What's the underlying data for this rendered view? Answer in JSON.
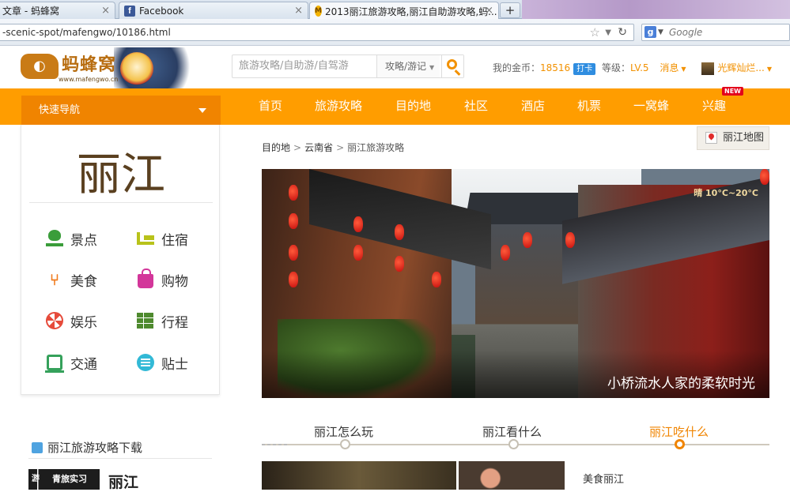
{
  "browser": {
    "tabs": [
      {
        "title": "文章 - 蚂蜂窝"
      },
      {
        "title": "Facebook"
      },
      {
        "title": "2013丽江旅游攻略,丽江自助游攻略,蚂..."
      }
    ],
    "new_tab": "+",
    "url": "-scenic-spot/mafengwo/10186.html",
    "search_engine": "Google",
    "search_engine_letter": "g"
  },
  "header": {
    "logo_text": "蚂蜂窝",
    "logo_url": "www.mafengwo.cn",
    "search_placeholder": "旅游攻略/自助游/自驾游",
    "search_scope": "攻略/游记",
    "coins_label": "我的金币：",
    "coins_value": "18516",
    "checkin": "打卡",
    "level_label": "等级：",
    "level_value": "LV.5",
    "messages": "消息",
    "username": "光辉灿烂..."
  },
  "nav": {
    "quick_nav": "快速导航",
    "items": [
      "首页",
      "旅游攻略",
      "目的地",
      "社区",
      "酒店",
      "机票",
      "一窝蜂",
      "兴趣"
    ],
    "new_badge": "NEW"
  },
  "sidebar": {
    "city": "丽江",
    "categories": [
      "景点",
      "住宿",
      "美食",
      "购物",
      "娱乐",
      "行程",
      "交通",
      "贴士"
    ],
    "download_title": "丽江旅游攻略下载",
    "download_cover_text": "青旅实习",
    "download_cover_side": "游",
    "download_city": "丽江"
  },
  "main": {
    "breadcrumb": [
      "目的地",
      "云南省",
      "丽江旅游攻略"
    ],
    "breadcrumb_sep": ">",
    "map_button": "丽江地图",
    "hero_caption": "小桥流水人家的柔软时光",
    "hero_weather": "晴 10°C~20°C",
    "timeline": [
      "丽江怎么玩",
      "丽江看什么",
      "丽江吃什么"
    ],
    "timeline_active": 2,
    "food_section_text": "美食丽江"
  },
  "colors": {
    "nav_orange": "#ff9d00",
    "quicknav_orange": "#f08400",
    "accent_orange": "#f29100"
  }
}
